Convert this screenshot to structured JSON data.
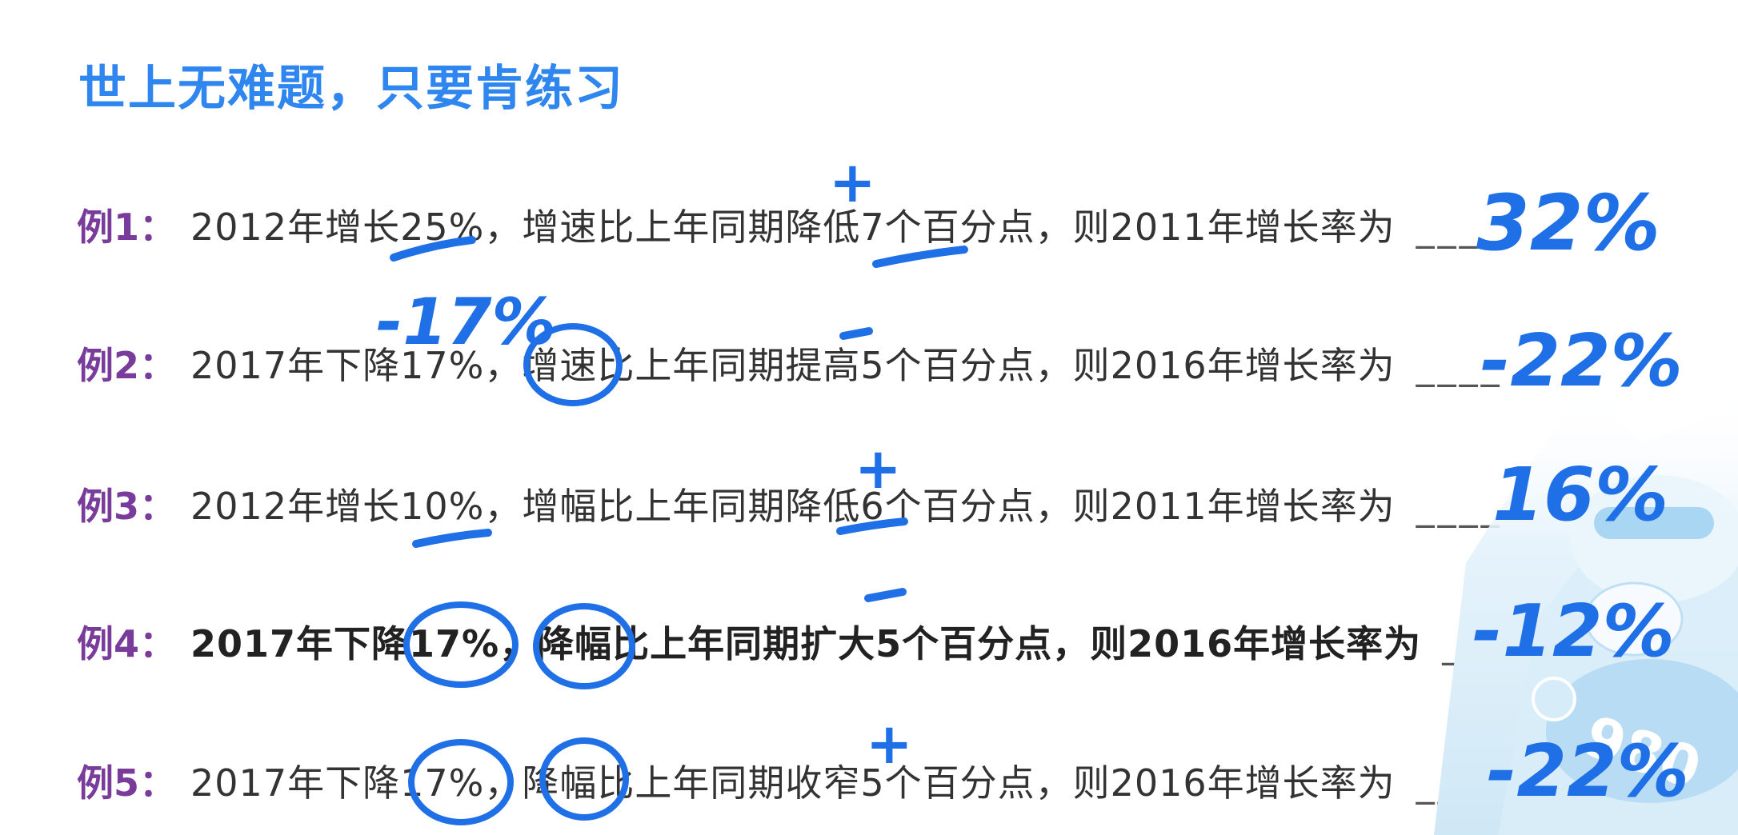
{
  "title": "世上无难题，只要肯练习",
  "examples": [
    {
      "label": "例1：",
      "statement": "2012年增长25%，增速比上年同期降低7个百分点，则2011年增长率为",
      "blank": "____",
      "handwritten_answer": "32%"
    },
    {
      "label": "例2：",
      "statement": "2017年下降17%，增速比上年同期提高5个百分点，则2016年增长率为",
      "blank": "____",
      "handwritten_answer": "-22%"
    },
    {
      "label": "例3：",
      "statement": "2012年增长10%，增幅比上年同期降低6个百分点，则2011年增长率为",
      "blank": "____",
      "handwritten_answer": "16%"
    },
    {
      "label": "例4：",
      "statement": "2017年下降17%，降幅比上年同期扩大5个百分点，则2016年增长率为",
      "blank": "____",
      "handwritten_answer": "-12%"
    },
    {
      "label": "例5：",
      "statement": "2017年下降17%，降幅比上年同期收窄5个百分点，则2016年增长率为",
      "blank": "____",
      "handwritten_answer": "-22%"
    }
  ],
  "annotations": {
    "plus": "+",
    "minus": "−",
    "neg17": "-17%"
  },
  "decoration": {
    "badge_text": "980"
  },
  "colors": {
    "title": "#2f86ee",
    "label": "#7a3c9a",
    "ink": "#1f6fe6",
    "text": "#333333"
  }
}
